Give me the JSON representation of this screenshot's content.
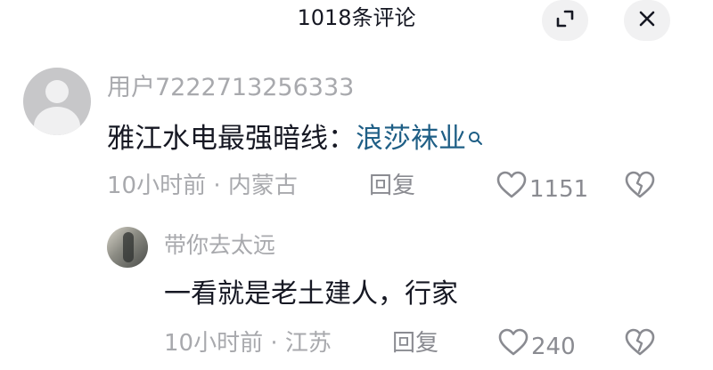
{
  "header": {
    "title": "1018条评论",
    "expand_icon": "expand-icon",
    "close_icon": "close-icon"
  },
  "comments": [
    {
      "username": "用户7222713256333",
      "avatar": "default-avatar",
      "text": "雅江水电最强暗线：",
      "link": "浪莎袜业",
      "time_location": "10小时前 · 内蒙古",
      "reply_label": "回复",
      "likes": "1151"
    },
    {
      "username": "带你去太远",
      "avatar": "photo-avatar",
      "text": "一看就是老土建人，行家",
      "time_location": "10小时前 · 江苏",
      "reply_label": "回复",
      "likes": "240"
    }
  ],
  "colors": {
    "text": "#161823",
    "muted": "#a8a9ad",
    "link": "#1f5f86",
    "button_bg": "#f1f1f2"
  }
}
